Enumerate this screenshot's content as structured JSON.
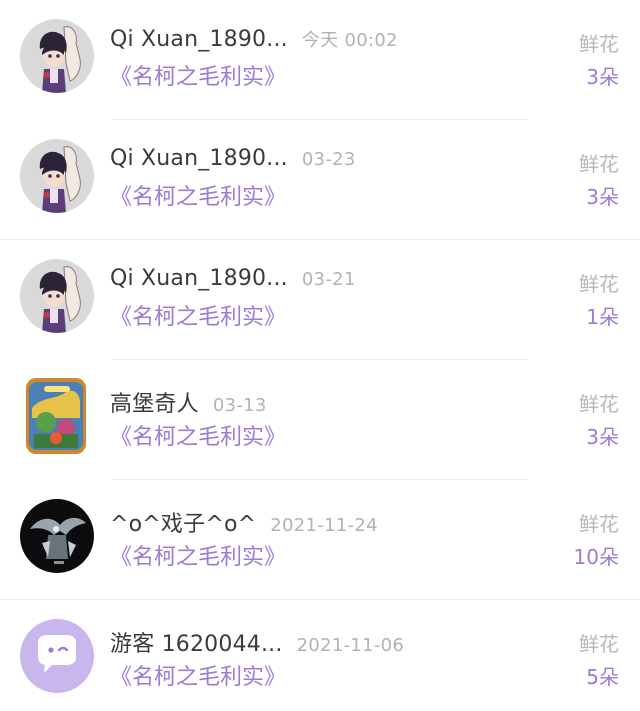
{
  "gifts": [
    {
      "user": "Qi Xuan_1890...",
      "date": "今天 00:02",
      "book": "《名柯之毛利实》",
      "gift_type": "鲜花",
      "gift_count": "3朵",
      "avatar": "anime-character-avatar"
    },
    {
      "user": "Qi Xuan_1890...",
      "date": "03-23",
      "book": "《名柯之毛利实》",
      "gift_type": "鲜花",
      "gift_count": "3朵",
      "avatar": "anime-character-avatar"
    },
    {
      "user": "Qi Xuan_1890...",
      "date": "03-21",
      "book": "《名柯之毛利实》",
      "gift_type": "鲜花",
      "gift_count": "1朵",
      "avatar": "anime-character-avatar"
    },
    {
      "user": "高堡奇人",
      "date": "03-13",
      "book": "《名柯之毛利实》",
      "gift_type": "鲜花",
      "gift_count": "3朵",
      "avatar": "game-artwork-avatar"
    },
    {
      "user": "^o^戏子^o^",
      "date": "2021-11-24",
      "book": "《名柯之毛利实》",
      "gift_type": "鲜花",
      "gift_count": "10朵",
      "avatar": "dark-dragon-avatar"
    },
    {
      "user": "游客 1620044...",
      "date": "2021-11-06",
      "book": "《名柯之毛利实》",
      "gift_type": "鲜花",
      "gift_count": "5朵",
      "avatar": "default-chat-bubble-avatar"
    }
  ],
  "colors": {
    "accent": "#9d7ad3",
    "name": "#3b3b3b",
    "muted": "#b3b3b3",
    "divider": "#efefef",
    "default_avatar_bg": "#c9b6ec"
  }
}
